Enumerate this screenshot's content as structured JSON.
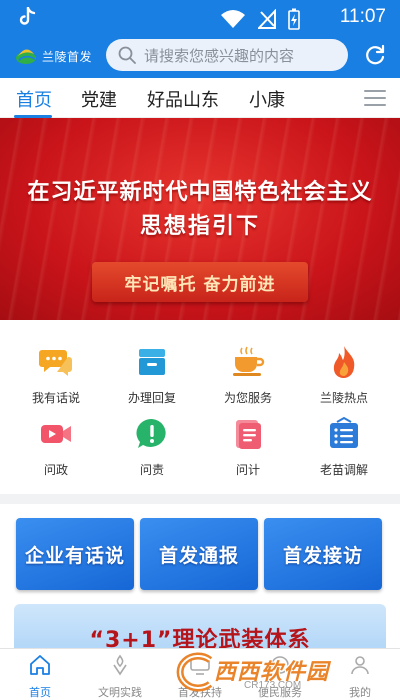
{
  "status_bar": {
    "time": "11:07"
  },
  "header": {
    "logo_text": "兰陵首发",
    "search_placeholder": "请搜索您感兴趣的内容"
  },
  "tabs": [
    {
      "label": "首页",
      "active": true
    },
    {
      "label": "党建",
      "active": false
    },
    {
      "label": "好品山东",
      "active": false
    },
    {
      "label": "小康",
      "active": false
    }
  ],
  "banner": {
    "line1": "在习近平新时代中国特色社会主义",
    "line2": "思想指引下",
    "ribbon": "牢记嘱托  奋力前进"
  },
  "quick_links": [
    {
      "label": "我有话说",
      "icon": "chat-bubbles-icon"
    },
    {
      "label": "办理回复",
      "icon": "inbox-tray-icon"
    },
    {
      "label": "为您服务",
      "icon": "coffee-cup-icon"
    },
    {
      "label": "兰陵热点",
      "icon": "flame-icon"
    },
    {
      "label": "问政",
      "icon": "video-camera-icon"
    },
    {
      "label": "问责",
      "icon": "exclamation-icon"
    },
    {
      "label": "问计",
      "icon": "document-icon"
    },
    {
      "label": "老苗调解",
      "icon": "list-board-icon"
    }
  ],
  "cards": [
    {
      "label": "企业有话说"
    },
    {
      "label": "首发通报"
    },
    {
      "label": "首发接访"
    }
  ],
  "promo": {
    "text": "“3+1”理论武装体系"
  },
  "bottom_nav": [
    {
      "label": "首页",
      "active": true
    },
    {
      "label": "文明实践",
      "active": false
    },
    {
      "label": "首发扶持",
      "active": false
    },
    {
      "label": "便民服务",
      "active": false
    },
    {
      "label": "我的",
      "active": false
    }
  ],
  "watermark": {
    "main": "西西软件园",
    "sub": "CR173.COM"
  },
  "colors": {
    "primary": "#1a7fe3",
    "banner_red": "#c9141a",
    "card_blue": "#1667d6"
  }
}
